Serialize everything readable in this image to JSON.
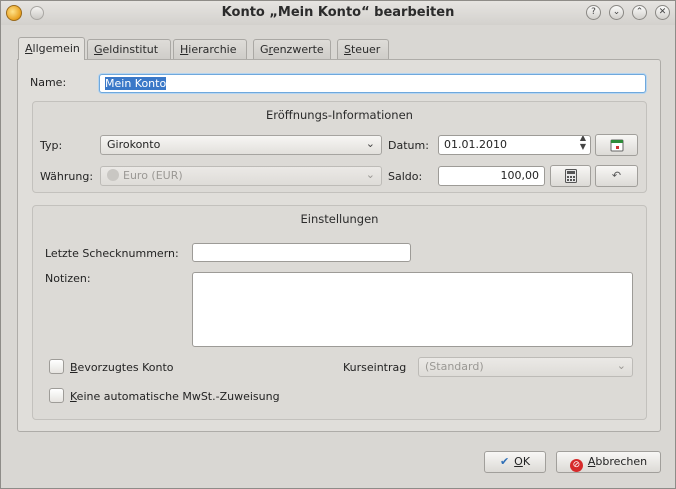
{
  "window": {
    "title": "Konto „Mein Konto“ bearbeiten",
    "buttons": {
      "help": "?",
      "minimize": "⌄",
      "maximize": "⌃",
      "close": "✕"
    }
  },
  "tabs": [
    {
      "pre": "",
      "u": "A",
      "post": "llgemein",
      "active": true
    },
    {
      "pre": "",
      "u": "G",
      "post": "eldinstitut",
      "active": false
    },
    {
      "pre": "",
      "u": "H",
      "post": "ierarchie",
      "active": false
    },
    {
      "pre": "G",
      "u": "r",
      "post": "enzwerte",
      "active": false
    },
    {
      "pre": "",
      "u": "S",
      "post": "teuer",
      "active": false
    }
  ],
  "name": {
    "label": "Name:",
    "value": "Mein Konto"
  },
  "opening": {
    "title": "Eröffnungs-Informationen",
    "type_label": "Typ:",
    "type_value": "Girokonto",
    "currency_label": "Währung:",
    "currency_value": "Euro (EUR)",
    "date_label": "Datum:",
    "date_value": "01.01.2010",
    "balance_label": "Saldo:",
    "balance_value": "100,00"
  },
  "settings": {
    "title": "Einstellungen",
    "last_check_label": "Letzte Schecknummern:",
    "last_check_value": "",
    "notes_label": "Notizen:",
    "notes_value": "",
    "preferred": {
      "u": "B",
      "rest": "evorzugtes Konto",
      "checked": false
    },
    "no_vat": {
      "u": "K",
      "rest": "eine automatische MwSt.-Zuweisung",
      "checked": false
    },
    "price_entry_label": "Kurseintrag",
    "price_entry_value": "(Standard)"
  },
  "footer": {
    "ok": {
      "u": "O",
      "rest": "K"
    },
    "cancel": {
      "u": "A",
      "rest": "bbrechen"
    }
  },
  "colors": {
    "accent": "#3a78c8",
    "cancel_icon": "#d62a2a",
    "ok_icon": "#2f6fb7"
  }
}
